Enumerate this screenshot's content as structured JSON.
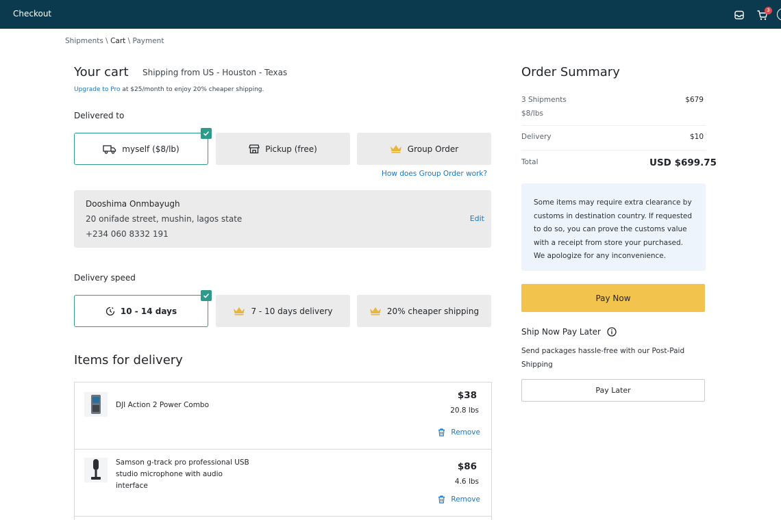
{
  "header": {
    "title": "Checkout",
    "cart_count": "3"
  },
  "breadcrumb": {
    "shipments": "Shipments",
    "sep1": " \\ ",
    "cart": "Cart",
    "sep2": " \\ ",
    "payment": "Payment"
  },
  "cart": {
    "title": "Your cart",
    "shipping_from": "Shipping from US - Houston - Texas",
    "upgrade_link": "Upgrade to Pro",
    "upgrade_text": " at $25/month to enjoy 20% cheaper shipping."
  },
  "delivered_to": {
    "label": "Delivered to",
    "options": [
      {
        "label": "myself ($8/lb)",
        "icon": "truck-icon",
        "selected": true
      },
      {
        "label": "Pickup (free)",
        "icon": "store-icon",
        "selected": false
      },
      {
        "label": "Group Order",
        "icon": "crown-icon",
        "selected": false
      }
    ],
    "group_link": "How does Group Order work?"
  },
  "address": {
    "name": "Dooshima Onmbayugh",
    "street": "20 onifade street, mushin, lagos state",
    "phone": "+234 060 8332 191",
    "edit_label": "Edit"
  },
  "delivery_speed": {
    "label": "Delivery speed",
    "options": [
      {
        "label": "10 - 14 days",
        "icon": "clock-icon",
        "selected": true
      },
      {
        "label": "7 - 10 days delivery",
        "icon": "crown-icon",
        "selected": false
      },
      {
        "label": "20% cheaper shipping",
        "icon": "crown-icon",
        "selected": false
      }
    ]
  },
  "items": {
    "title": "Items for delivery",
    "list": [
      {
        "name": "DJI Action 2 Power Combo",
        "price": "$38",
        "weight": "20.8 lbs",
        "remove_label": "Remove"
      },
      {
        "name": "Samson g-track pro professional USB studio microphone with audio interface",
        "price": "$86",
        "weight": "4.6 lbs",
        "remove_label": "Remove"
      }
    ]
  },
  "summary": {
    "title": "Order Summary",
    "shipments_label": "3 Shipments",
    "shipments_value": "$679",
    "rate": "$8/lbs",
    "delivery_label": "Delivery",
    "delivery_value": "$10",
    "total_label": "Total",
    "total_value": "USD $699.75",
    "notice": "Some items may require extra clearance by customs in destination country. If requested to do so, you can prove the customs value with a receipt from store your purchased. We apologize for any inconvenience.",
    "pay_now": "Pay Now",
    "snpl_title": "Ship Now Pay Later",
    "snpl_desc": "Send packages hassle-free with our Post-Paid Shipping",
    "pay_later": "Pay Later"
  },
  "colors": {
    "header_bg": "#0b3a4f",
    "accent_teal": "#2e9a8c",
    "link_blue": "#1877c9",
    "pay_yellow": "#f2c44d",
    "crown_gold": "#e8b63a",
    "notice_bg": "#edf4fc"
  }
}
